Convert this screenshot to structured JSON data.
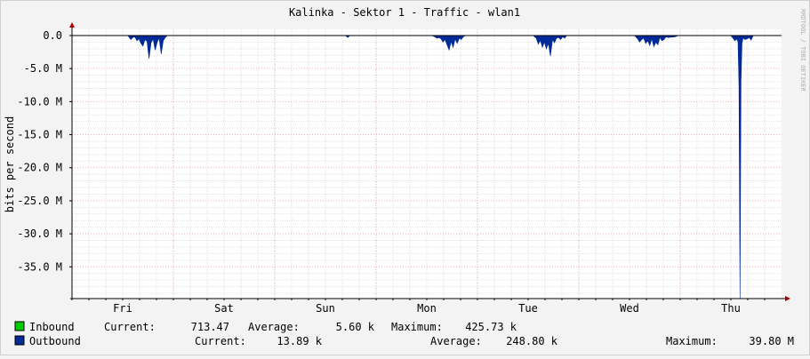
{
  "chart_data": {
    "type": "area",
    "title": "Kalinka - Sektor 1 - Traffic - wlan1",
    "ylabel": "bits per second",
    "watermark": "RRDTOOL / TOBI OETIKER",
    "ylim": [
      -39.8,
      0
    ],
    "yticks": [
      {
        "value": 0,
        "label": "0.0"
      },
      {
        "value": -5,
        "label": "-5.0 M"
      },
      {
        "value": -10,
        "label": "-10.0 M"
      },
      {
        "value": -15,
        "label": "-15.0 M"
      },
      {
        "value": -20,
        "label": "-20.0 M"
      },
      {
        "value": -25,
        "label": "-25.0 M"
      },
      {
        "value": -30,
        "label": "-30.0 M"
      },
      {
        "value": -35,
        "label": "-35.0 M"
      }
    ],
    "xlim": [
      0,
      7
    ],
    "xticks": [
      {
        "value": 0.5,
        "label": "Fri"
      },
      {
        "value": 1.5,
        "label": "Sat"
      },
      {
        "value": 2.5,
        "label": "Sun"
      },
      {
        "value": 3.5,
        "label": "Mon"
      },
      {
        "value": 4.5,
        "label": "Tue"
      },
      {
        "value": 5.5,
        "label": "Wed"
      },
      {
        "value": 6.5,
        "label": "Thu"
      }
    ],
    "grid": true,
    "series": [
      {
        "name": "Outbound",
        "color": "#002a97",
        "x": [
          0.55,
          0.57,
          0.58,
          0.6,
          0.62,
          0.64,
          0.66,
          0.68,
          0.7,
          0.72,
          0.74,
          0.76,
          0.78,
          0.8,
          0.82,
          0.84,
          0.86,
          0.88,
          0.9,
          0.92,
          0.94,
          2.7,
          2.72,
          2.74,
          3.55,
          3.58,
          3.6,
          3.62,
          3.64,
          3.66,
          3.68,
          3.7,
          3.72,
          3.74,
          3.76,
          3.78,
          3.8,
          3.82,
          3.84,
          3.86,
          3.88,
          4.55,
          4.58,
          4.6,
          4.62,
          4.64,
          4.66,
          4.68,
          4.7,
          4.72,
          4.74,
          4.76,
          4.78,
          4.8,
          4.82,
          4.84,
          4.86,
          4.88,
          5.55,
          5.58,
          5.6,
          5.62,
          5.64,
          5.66,
          5.68,
          5.7,
          5.72,
          5.74,
          5.76,
          5.78,
          5.8,
          5.82,
          5.84,
          5.86,
          5.88,
          5.95,
          5.98,
          6.5,
          6.52,
          6.54,
          6.56,
          6.57,
          6.58,
          6.59,
          6.6,
          6.61,
          6.62,
          6.64,
          6.66,
          6.68,
          6.7,
          6.72
        ],
        "values": [
          0,
          -0.4,
          -0.6,
          -0.3,
          -0.2,
          -0.8,
          -0.5,
          -1.2,
          -1.6,
          -0.6,
          -0.9,
          -3.5,
          -1.1,
          -0.5,
          -2.2,
          -1.0,
          -0.4,
          -2.8,
          -0.8,
          -0.3,
          0,
          0,
          -0.3,
          0,
          0,
          -0.2,
          -0.4,
          -0.3,
          -0.5,
          -1.0,
          -0.6,
          -1.4,
          -2.2,
          -0.9,
          -1.8,
          -0.5,
          -1.2,
          -0.4,
          -0.6,
          -0.2,
          0,
          0,
          -0.4,
          -1.3,
          -0.7,
          -1.8,
          -1.0,
          -2.0,
          -1.2,
          -3.1,
          -0.6,
          -1.1,
          -0.4,
          -0.3,
          -0.6,
          -0.2,
          -0.4,
          0,
          0,
          -0.5,
          -1.0,
          -0.6,
          -0.4,
          -1.2,
          -0.8,
          -1.5,
          -0.5,
          -1.7,
          -1.0,
          -1.4,
          -0.3,
          -0.8,
          -0.6,
          -0.2,
          -0.3,
          -0.2,
          0,
          0,
          -0.4,
          -0.8,
          -0.5,
          -1.0,
          -7.5,
          -39.8,
          -7.0,
          -1.2,
          -0.4,
          -0.6,
          -0.5,
          -0.3,
          -0.7,
          0
        ]
      }
    ]
  },
  "legend": [
    {
      "name": "Inbound",
      "color": "#00cc00",
      "current_label": "Current:",
      "current": "713.47",
      "average_label": "Average:",
      "average": "5.60 k",
      "maximum_label": "Maximum:",
      "maximum": "425.73 k"
    },
    {
      "name": "Outbound",
      "color": "#002a97",
      "current_label": "Current:",
      "current": "13.89 k",
      "average_label": "Average:",
      "average": "248.80 k",
      "maximum_label": "Maximum:",
      "maximum": "39.80 M"
    }
  ],
  "colors": {
    "background": "#f3f3f3",
    "plot_background": "#ffffff",
    "grid_minor": "#e2e2e2",
    "grid_major": "#f0b0b0",
    "axis": "#000000",
    "arrow": "#b00000"
  }
}
